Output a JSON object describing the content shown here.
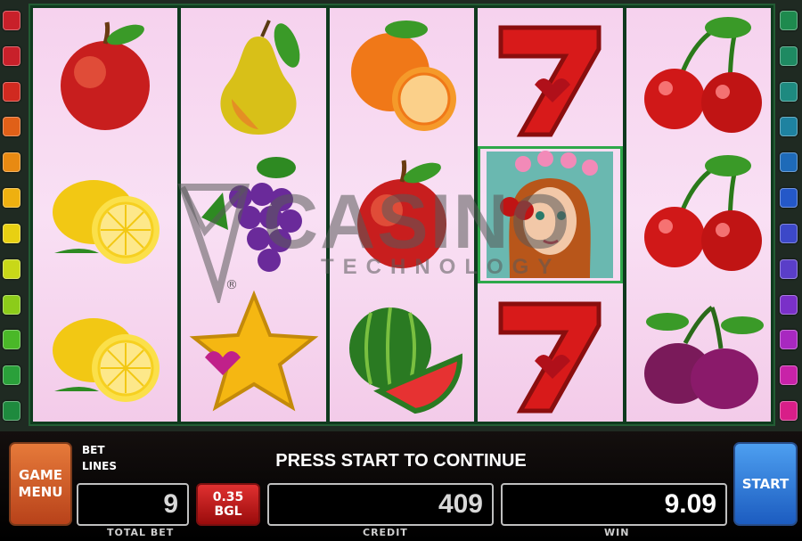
{
  "side_indicators": {
    "left": [
      "#c8202a",
      "#c8202a",
      "#d02a20",
      "#e06018",
      "#e88a12",
      "#eeb010",
      "#e8d012",
      "#c8d818",
      "#8ccc1a",
      "#4ab828",
      "#2aa03a",
      "#1e8a3e"
    ],
    "right": [
      "#1e8a4e",
      "#1e8a62",
      "#1e8a80",
      "#1e82a0",
      "#1e6ab8",
      "#2458c8",
      "#3c48c8",
      "#5a3ec8",
      "#7a30c8",
      "#a828c0",
      "#c822a8",
      "#d81e88"
    ]
  },
  "reels": [
    [
      "apple",
      "lemon",
      "lemon"
    ],
    [
      "pear",
      "grapes",
      "star"
    ],
    [
      "orange",
      "apple",
      "watermelon"
    ],
    [
      "seven",
      "fairy",
      "seven"
    ],
    [
      "cherries",
      "cherries",
      "plum"
    ]
  ],
  "watermark": {
    "line1": "CASINO",
    "line2": "TECHNOLOGY",
    "reg": "®"
  },
  "panel": {
    "menu_label_1": "GAME",
    "menu_label_2": "MENU",
    "bet_label": "BET",
    "lines_label": "LINES",
    "message": "PRESS START TO CONTINUE",
    "total_bet_value": "9",
    "total_bet_caption": "TOTAL BET",
    "denom_value": "0.35",
    "denom_currency": "BGL",
    "credit_value": "409",
    "credit_caption": "CREDIT",
    "win_value": "9.09",
    "win_caption": "WIN",
    "start_label": "START"
  }
}
